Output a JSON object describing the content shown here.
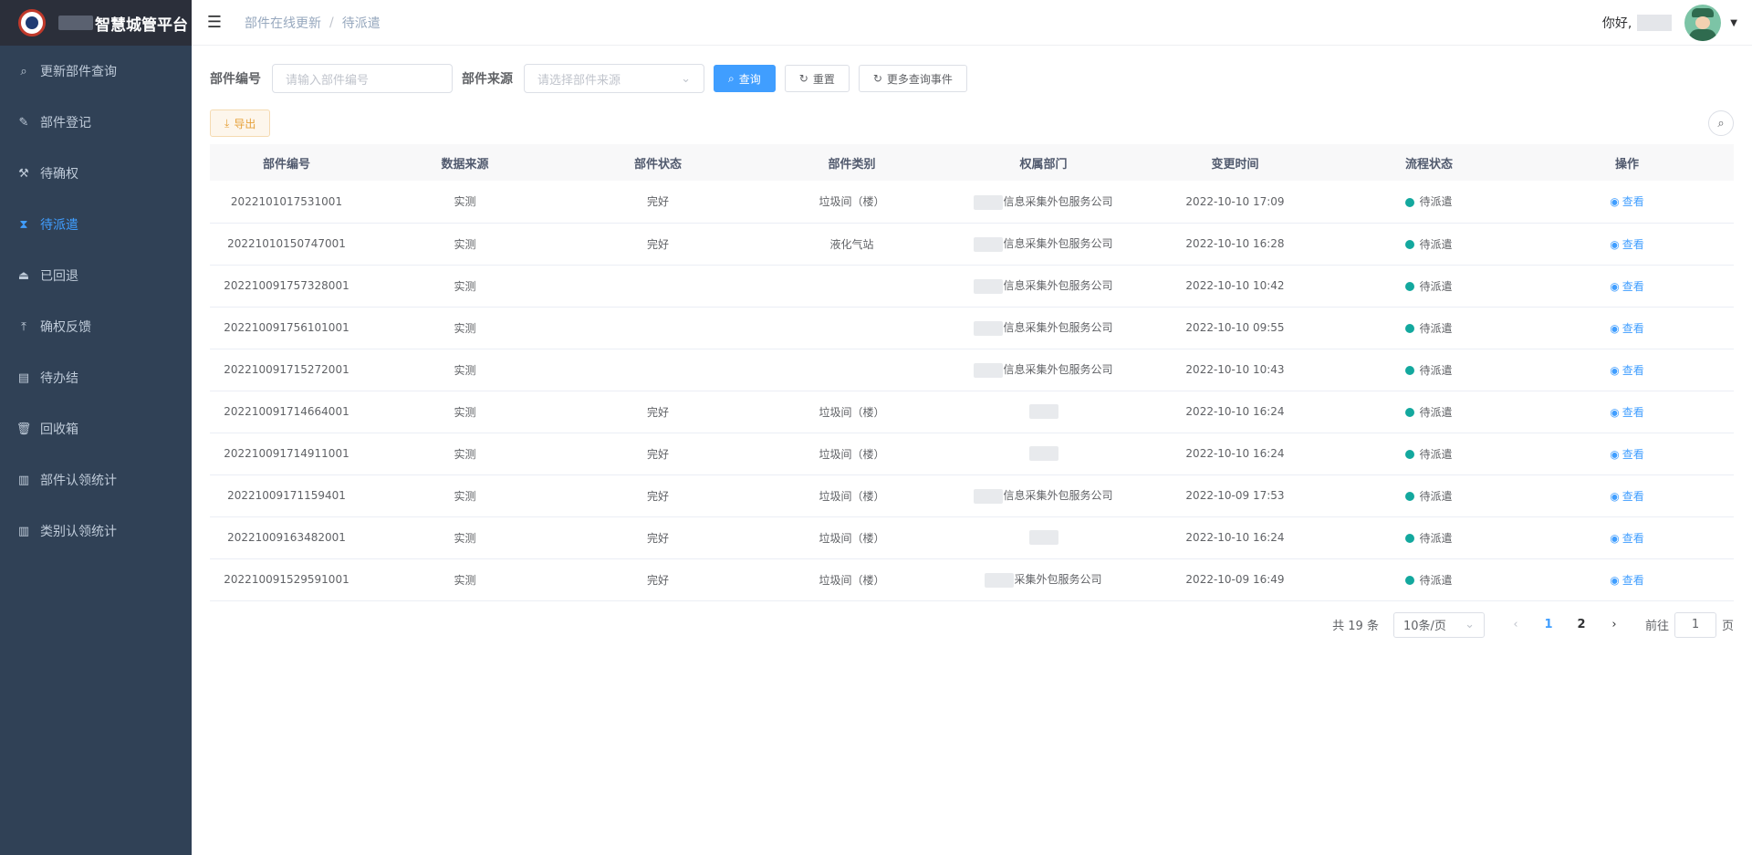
{
  "app": {
    "title": "智慧城管平台"
  },
  "sidebar": {
    "items": [
      {
        "label": "更新部件查询",
        "icon": "search-icon",
        "active": false
      },
      {
        "label": "部件登记",
        "icon": "edit-icon",
        "active": false
      },
      {
        "label": "待确权",
        "icon": "hammer-icon",
        "active": false
      },
      {
        "label": "待派遣",
        "icon": "hourglass-icon",
        "active": true
      },
      {
        "label": "已回退",
        "icon": "eject-icon",
        "active": false
      },
      {
        "label": "确权反馈",
        "icon": "upload-icon",
        "active": false
      },
      {
        "label": "待办结",
        "icon": "document-icon",
        "active": false
      },
      {
        "label": "回收箱",
        "icon": "trash-icon",
        "active": false
      },
      {
        "label": "部件认领统计",
        "icon": "bar-chart-icon",
        "active": false
      },
      {
        "label": "类别认领统计",
        "icon": "bar-chart-icon",
        "active": false
      }
    ]
  },
  "header": {
    "breadcrumb": [
      "部件在线更新",
      "待派遣"
    ],
    "greeting": "你好,"
  },
  "search": {
    "code_label": "部件编号",
    "code_placeholder": "请输入部件编号",
    "source_label": "部件来源",
    "source_placeholder": "请选择部件来源",
    "query_label": "查询",
    "reset_label": "重置",
    "more_label": "更多查询事件"
  },
  "toolbar": {
    "export_label": "导出"
  },
  "table": {
    "columns": [
      "部件编号",
      "数据来源",
      "部件状态",
      "部件类别",
      "权属部门",
      "变更时间",
      "流程状态",
      "操作"
    ],
    "rows": [
      {
        "code": "2022101017531001",
        "source": "实测",
        "status": "完好",
        "category": "垃圾间（楼）",
        "dept": "信息采集外包服务公司",
        "time": "2022-10-10 17:09",
        "flow": "待派遣",
        "action": "查看"
      },
      {
        "code": "20221010150747001",
        "source": "实测",
        "status": "完好",
        "category": "液化气站",
        "dept": "信息采集外包服务公司",
        "time": "2022-10-10 16:28",
        "flow": "待派遣",
        "action": "查看"
      },
      {
        "code": "202210091757328001",
        "source": "实测",
        "status": "",
        "category": "",
        "dept": "信息采集外包服务公司",
        "time": "2022-10-10 10:42",
        "flow": "待派遣",
        "action": "查看"
      },
      {
        "code": "202210091756101001",
        "source": "实测",
        "status": "",
        "category": "",
        "dept": "信息采集外包服务公司",
        "time": "2022-10-10 09:55",
        "flow": "待派遣",
        "action": "查看"
      },
      {
        "code": "202210091715272001",
        "source": "实测",
        "status": "",
        "category": "",
        "dept": "信息采集外包服务公司",
        "time": "2022-10-10 10:43",
        "flow": "待派遣",
        "action": "查看"
      },
      {
        "code": "202210091714664001",
        "source": "实测",
        "status": "完好",
        "category": "垃圾间（楼）",
        "dept": "",
        "time": "2022-10-10 16:24",
        "flow": "待派遣",
        "action": "查看"
      },
      {
        "code": "202210091714911001",
        "source": "实测",
        "status": "完好",
        "category": "垃圾间（楼）",
        "dept": "",
        "time": "2022-10-10 16:24",
        "flow": "待派遣",
        "action": "查看"
      },
      {
        "code": "20221009171159401",
        "source": "实测",
        "status": "完好",
        "category": "垃圾间（楼）",
        "dept": "信息采集外包服务公司",
        "time": "2022-10-09 17:53",
        "flow": "待派遣",
        "action": "查看"
      },
      {
        "code": "20221009163482001",
        "source": "实测",
        "status": "完好",
        "category": "垃圾间（楼）",
        "dept": "",
        "time": "2022-10-10 16:24",
        "flow": "待派遣",
        "action": "查看"
      },
      {
        "code": "202210091529591001",
        "source": "实测",
        "status": "完好",
        "category": "垃圾间（楼）",
        "dept": "采集外包服务公司",
        "time": "2022-10-09 16:49",
        "flow": "待派遣",
        "action": "查看"
      }
    ]
  },
  "pagination": {
    "total": "共 19 条",
    "page_size": "10条/页",
    "pages": [
      "1",
      "2"
    ],
    "current": "1",
    "goto_prefix": "前往",
    "goto_value": "1",
    "goto_suffix": "页"
  },
  "colors": {
    "sidebar_bg": "#304156",
    "primary": "#409eff",
    "status_dot": "#13a89e",
    "warning": "#e6a23c"
  }
}
